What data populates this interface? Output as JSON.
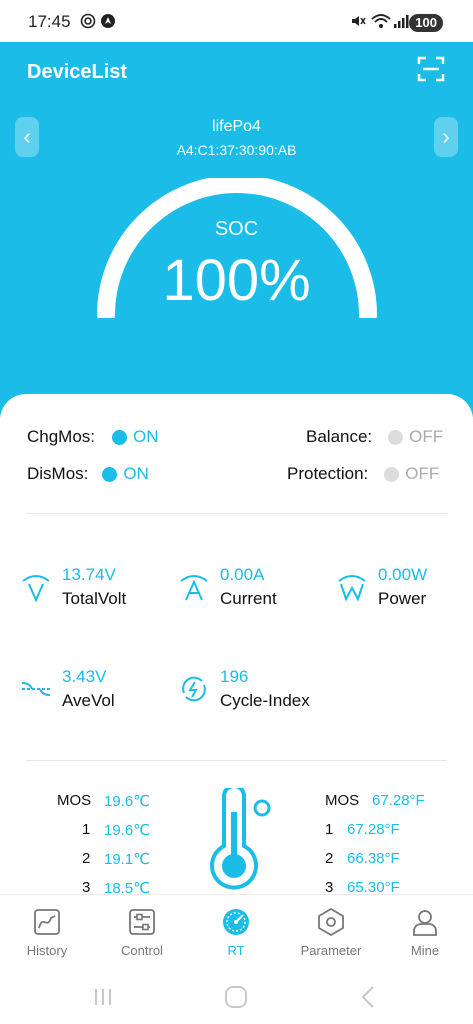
{
  "status_bar": {
    "time": "17:45",
    "battery": "100",
    "icons": [
      "target-icon",
      "navigation-icon",
      "mute-icon",
      "wifi-icon",
      "signal-icon",
      "battery-icon"
    ]
  },
  "header": {
    "title": "DeviceList",
    "scan_icon": "scan-icon",
    "device_name": "lifePo4",
    "device_mac": "A4:C1:37:30:90:AB",
    "prev_arrow": "‹",
    "next_arrow": "›"
  },
  "gauge": {
    "label": "SOC",
    "value": "100%",
    "level": 1.0
  },
  "status": {
    "chgmos": {
      "label": "ChgMos:",
      "value": "ON",
      "on": true
    },
    "dismos": {
      "label": "DisMos:",
      "value": "ON",
      "on": true
    },
    "balance": {
      "label": "Balance:",
      "value": "OFF",
      "on": false
    },
    "protection": {
      "label": "Protection:",
      "value": "OFF",
      "on": false
    }
  },
  "metrics": {
    "total_volt": {
      "value": "13.74V",
      "label": "TotalVolt"
    },
    "current": {
      "value": "0.00A",
      "label": "Current"
    },
    "power": {
      "value": "0.00W",
      "label": "Power"
    },
    "ave_vol": {
      "value": "3.43V",
      "label": "AveVol"
    },
    "cycle_index": {
      "value": "196",
      "label": "Cycle-Index"
    }
  },
  "temps_c": [
    {
      "label": "MOS",
      "value": "19.6℃"
    },
    {
      "label": "1",
      "value": "19.6℃"
    },
    {
      "label": "2",
      "value": "19.1℃"
    },
    {
      "label": "3",
      "value": "18.5℃"
    }
  ],
  "temps_f": [
    {
      "label": "MOS",
      "value": "67.28°F"
    },
    {
      "label": "1",
      "value": "67.28°F"
    },
    {
      "label": "2",
      "value": "66.38°F"
    },
    {
      "label": "3",
      "value": "65.30°F"
    }
  ],
  "tabs": [
    {
      "label": "History",
      "icon": "chart-icon"
    },
    {
      "label": "Control",
      "icon": "sliders-icon"
    },
    {
      "label": "RT",
      "icon": "gauge-icon",
      "active": true
    },
    {
      "label": "Parameter",
      "icon": "hexagon-nut-icon"
    },
    {
      "label": "Mine",
      "icon": "user-icon"
    }
  ],
  "colors": {
    "accent": "#1bbde8",
    "off": "#dcdcdc"
  }
}
